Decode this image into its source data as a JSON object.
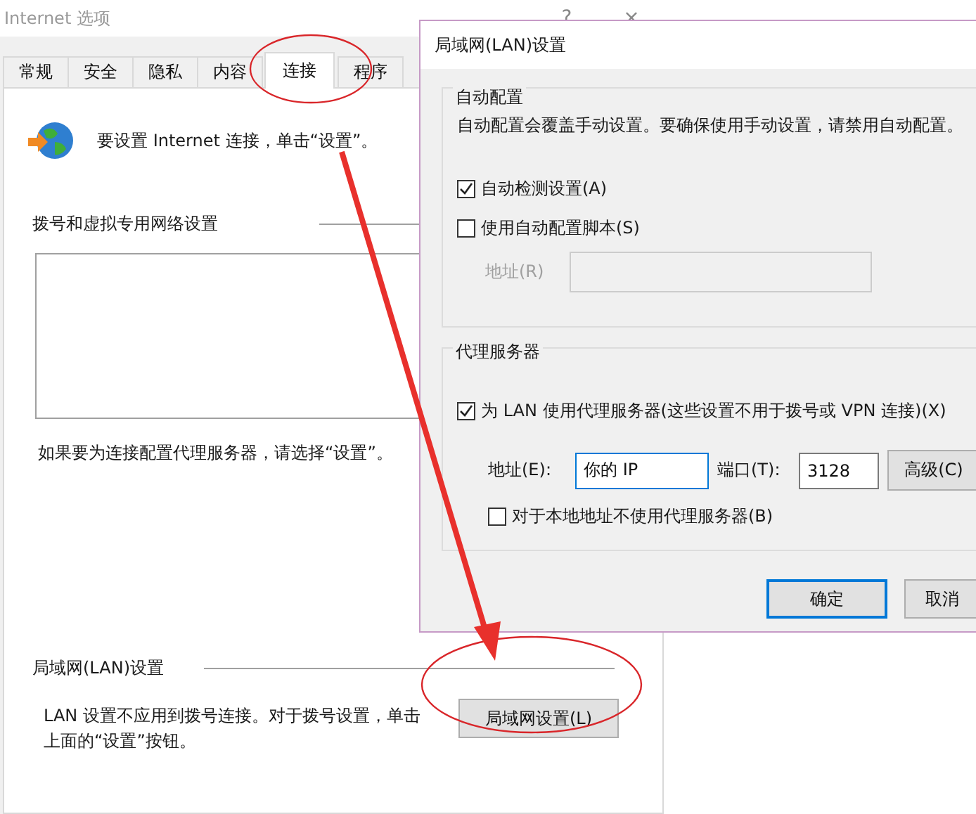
{
  "back_window": {
    "title": "Internet 选项",
    "help": "?",
    "close": "×",
    "tabs": [
      {
        "label": "常规",
        "selected": false
      },
      {
        "label": "安全",
        "selected": false
      },
      {
        "label": "隐私",
        "selected": false
      },
      {
        "label": "内容",
        "selected": false
      },
      {
        "label": "连接",
        "selected": true
      },
      {
        "label": "程序",
        "selected": false
      }
    ],
    "intro": "要设置 Internet 连接，单击“设置”。",
    "dialup_heading": "拨号和虚拟专用网络设置",
    "proxy_hint": "如果要为连接配置代理服务器，请选择“设置”。",
    "lan_heading": "局域网(LAN)设置",
    "lan_note_lines": [
      "LAN 设置不应用到拨号连接。对于拨号设置，单击",
      "上面的“设置”按钮。"
    ],
    "lan_button": "局域网设置(L)"
  },
  "lan_dialog": {
    "title": "局域网(LAN)设置",
    "auto_config": {
      "legend": "自动配置",
      "description": "自动配置会覆盖手动设置。要确保使用手动设置，请禁用自动配置。",
      "checks": [
        {
          "label": "自动检测设置(A)",
          "checked": true
        },
        {
          "label": "使用自动配置脚本(S)",
          "checked": false
        }
      ],
      "script_address": {
        "label": "地址(R)",
        "disabled": true
      }
    },
    "proxy": {
      "legend": "代理服务器",
      "use_proxy": {
        "label": "为 LAN 使用代理服务器(这些设置不用于拨号或 VPN 连接)(X)",
        "checked": true
      },
      "address": {
        "label": "地址(E):",
        "value": "你的 IP",
        "focused": true
      },
      "port": {
        "label": "端口(T):",
        "value": "3128"
      },
      "advanced": "高级(C)",
      "bypass": {
        "label": "对于本地地址不使用代理服务器(B)",
        "checked": false
      }
    },
    "buttons": [
      {
        "label": "确定",
        "default": true
      },
      {
        "label": "取消",
        "default": false
      }
    ]
  }
}
